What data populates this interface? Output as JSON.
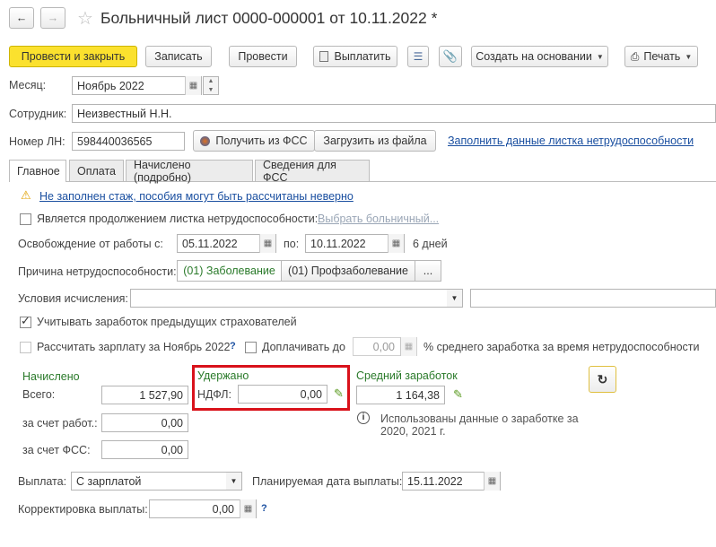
{
  "header": {
    "title": "Больничный лист 0000-000001 от 10.11.2022 *"
  },
  "toolbar": {
    "post_close": "Провести и закрыть",
    "save": "Записать",
    "post": "Провести",
    "pay": "Выплатить",
    "create_based": "Создать на основании",
    "print": "Печать"
  },
  "month": {
    "label": "Месяц:",
    "value": "Ноябрь 2022"
  },
  "employee": {
    "label": "Сотрудник:",
    "value": "Неизвестный Н.Н."
  },
  "sick_number": {
    "label": "Номер ЛН:",
    "value": "598440036565",
    "get_fss": "Получить из ФСС",
    "load_file": "Загрузить из файла",
    "fill_link": "Заполнить данные листка нетрудоспособности"
  },
  "tabs": [
    "Главное",
    "Оплата",
    "Начислено (подробно)",
    "Сведения для ФСС"
  ],
  "warning": "Не заполнен стаж, пособия могут быть рассчитаны неверно",
  "continuation": {
    "label": "Является продолжением листка нетрудоспособности:",
    "link": "Выбрать больничный..."
  },
  "release": {
    "label": "Освобождение от работы с:",
    "from": "05.11.2022",
    "to_label": "по:",
    "to": "10.11.2022",
    "days": "6 дней"
  },
  "reason": {
    "label": "Причина нетрудоспособности:",
    "opt1": "(01) Заболевание",
    "opt2": "(01) Профзаболевание",
    "more": "..."
  },
  "conditions": {
    "label": "Условия исчисления:"
  },
  "prev_employers": {
    "label": "Учитывать заработок предыдущих страхователей"
  },
  "calc_salary": {
    "label": "Рассчитать зарплату за Ноябрь 2022",
    "q": "?"
  },
  "topup": {
    "label": "Доплачивать до",
    "value": "0,00",
    "suffix": "% среднего заработка за время нетрудоспособности"
  },
  "accrued": {
    "title": "Начислено",
    "total_label": "Всего:",
    "total": "1 527,90",
    "employer_label": "за счет работ.:",
    "employer": "0,00",
    "fss_label": "за счет ФСС:",
    "fss": "0,00"
  },
  "withheld": {
    "title": "Удержано",
    "ndfl_label": "НДФЛ:",
    "ndfl": "0,00"
  },
  "average": {
    "title": "Средний заработок",
    "value": "1 164,38",
    "info": "Использованы данные о заработке за",
    "info2": "2020,  2021 г."
  },
  "payout": {
    "label": "Выплата:",
    "value": "С зарплатой",
    "date_label": "Планируемая дата выплаты:",
    "date": "15.11.2022"
  },
  "correction": {
    "label": "Корректировка выплаты:",
    "value": "0,00",
    "q": "?"
  },
  "colors": {
    "primary": "#fbe12e",
    "highlight": "#d9121b",
    "green": "#2a7a2a",
    "link": "#1a4fa0"
  }
}
